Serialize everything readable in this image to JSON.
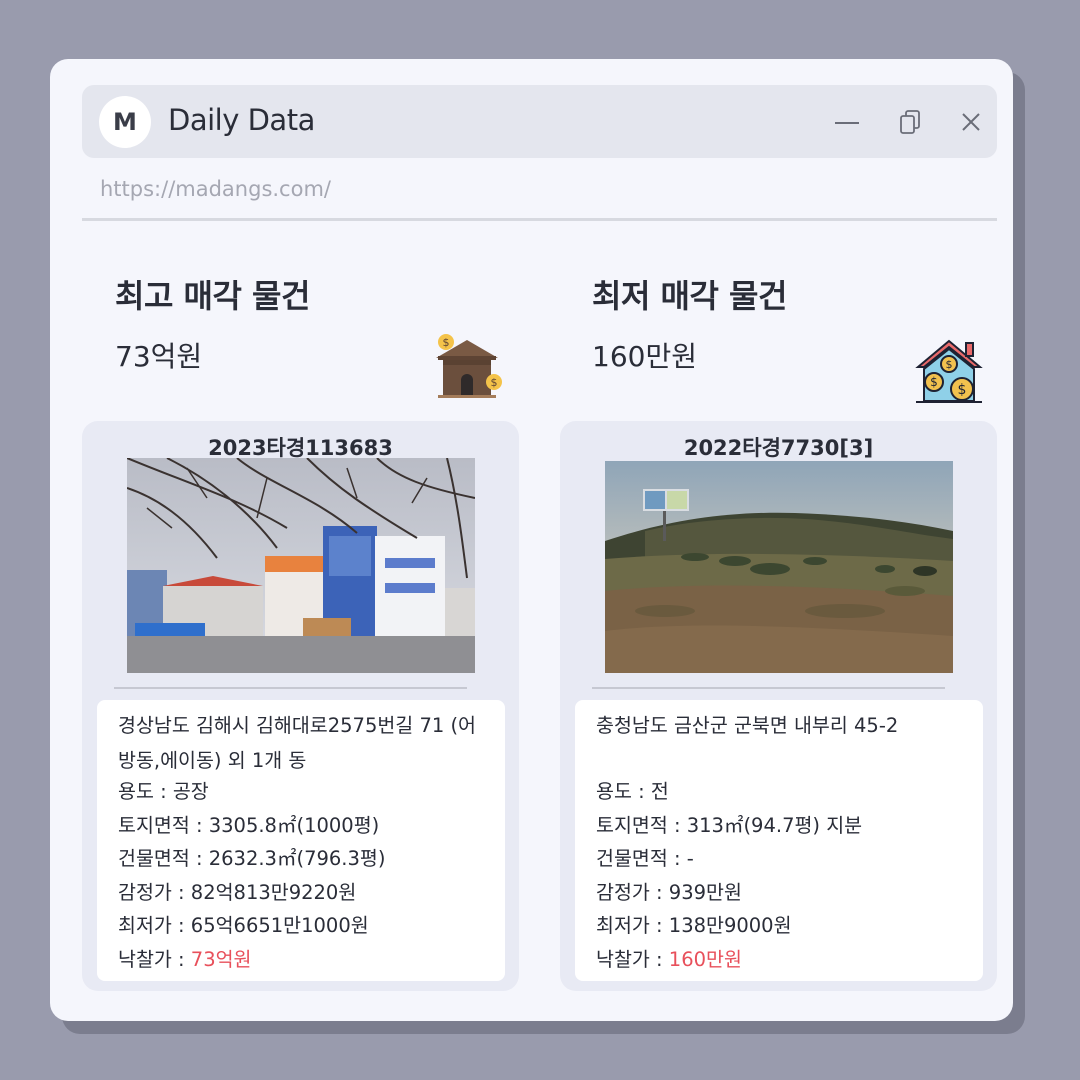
{
  "window": {
    "logo_letter": "M",
    "title": "Daily Data",
    "url": "https://madangs.com/",
    "controls": [
      "minimize-icon",
      "copy-icon",
      "close-icon"
    ]
  },
  "highest": {
    "heading": "최고 매각 물건",
    "amount": "73억원",
    "icon": "house-money-icon",
    "case_no": "2023타경113683",
    "address": "경상남도 김해시 김해대로2575번길 71 (어방동,에이동) 외 1개 동",
    "usage": "용도 : 공장",
    "land_area": "토지면적 : 3305.8㎡(1000평)",
    "building_area": "건물면적 : 2632.3㎡(796.3평)",
    "appraisal": "감정가 : 82억813만9220원",
    "minimum": "최저가 : 65억6651만1000원",
    "winning_label": "낙찰가 : ",
    "winning_value": "73억원"
  },
  "lowest": {
    "heading": "최저 매각 물건",
    "amount": "160만원",
    "icon": "house-coins-icon",
    "case_no": "2022타경7730[3]",
    "address": "충청남도 금산군 군북면 내부리 45-2",
    "usage": "용도 :  전",
    "land_area": "토지면적 : 313㎡(94.7평) 지분",
    "building_area": "건물면적 : -",
    "appraisal": "감정가 : 939만원",
    "minimum": "최저가 : 138만9000원",
    "winning_label": "낙찰가 : ",
    "winning_value": "160만원"
  },
  "colors": {
    "background": "#999bad",
    "window": "#f5f6fc",
    "card": "#e8eaf4",
    "highlight_price": "#e8505b"
  }
}
